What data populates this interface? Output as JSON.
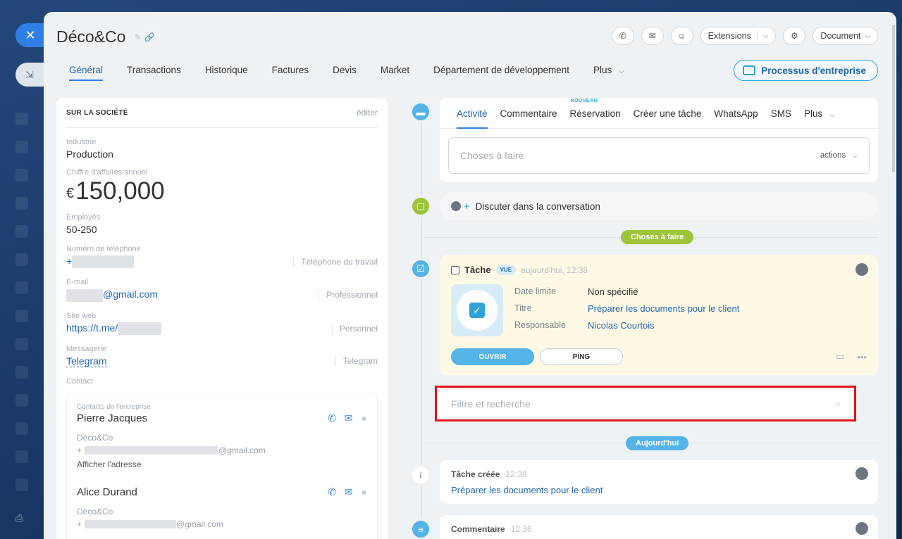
{
  "company": {
    "title": "Déco&Co"
  },
  "toolbar": {
    "extensions_label": "Extensions",
    "document_label": "Document"
  },
  "tabs": [
    {
      "label": "Général"
    },
    {
      "label": "Transactions"
    },
    {
      "label": "Historique"
    },
    {
      "label": "Factures"
    },
    {
      "label": "Devis"
    },
    {
      "label": "Market"
    },
    {
      "label": "Département de développement"
    },
    {
      "label": "Plus"
    }
  ],
  "process_button": "Processus d'entreprise",
  "about": {
    "header": "SUR LA SOCIÉTÉ",
    "edit": "éditer",
    "industry_label": "Industrie",
    "industry_value": "Production",
    "revenue_label": "Chiffre d'affaires annuel",
    "revenue_currency": "€",
    "revenue_value": "150,000",
    "employees_label": "Employés",
    "employees_value": "50-250",
    "phone_label": "Numéro de téléphone",
    "phone_prefix": "+",
    "phone_type": "Téléphone du travail",
    "email_label": "E-mail",
    "email_suffix": "@gmail.com",
    "email_type": "Professionnel",
    "website_label": "Site web",
    "website_prefix": "https://t.me/",
    "website_type": "Personnel",
    "messenger_label": "Messagerie",
    "messenger_value": "Telegram",
    "messenger_type": "Telegram",
    "contact_label": "Contact"
  },
  "contacts": [
    {
      "sublabel": "Contacts de l'entreprise",
      "name": "Pierre Jacques",
      "company": "Déco&Co",
      "phone_prefix": "+",
      "email_suffix": "@gmail.com",
      "address_link": "Afficher l'adresse"
    },
    {
      "name": "Alice Durand",
      "company": "Déco&Co",
      "phone_prefix": "+",
      "email_suffix": "@gmail.com"
    }
  ],
  "activity": {
    "tabs": [
      {
        "label": "Activité"
      },
      {
        "label": "Commentaire"
      },
      {
        "label": "Réservation",
        "badge": "NOUVEAU"
      },
      {
        "label": "Créer une tâche"
      },
      {
        "label": "WhatsApp"
      },
      {
        "label": "SMS"
      },
      {
        "label": "Plus"
      }
    ],
    "todo_placeholder": "Choses à faire",
    "actions_label": "actions"
  },
  "chat": {
    "label": "Discuter dans la conversation"
  },
  "separators": {
    "todo": "Choses à faire",
    "today": "Aujourd'hui"
  },
  "task": {
    "title": "Tâche",
    "badge": "VUE",
    "time": "aujourd'hui, 12:38",
    "deadline_label": "Date limite",
    "deadline_value": "Non spécifié",
    "title_label": "Titre",
    "title_value": "Préparer les documents pour le client",
    "responsible_label": "Responsable",
    "responsible_value": "Nicolas Courtois",
    "open_btn": "OUVRIR",
    "ping_btn": "PING"
  },
  "filter": {
    "placeholder": "Filtre et recherche"
  },
  "history": [
    {
      "title": "Tâche créée",
      "time": "12:38",
      "link": "Préparer les documents pour le client"
    },
    {
      "title": "Commentaire",
      "time": "12:36"
    }
  ],
  "colors": {
    "accent": "#2f7fe6",
    "link": "#2066b0",
    "todo_badge": "#9dc53a",
    "today_badge": "#54b4e8",
    "highlight": "#e0141b"
  }
}
